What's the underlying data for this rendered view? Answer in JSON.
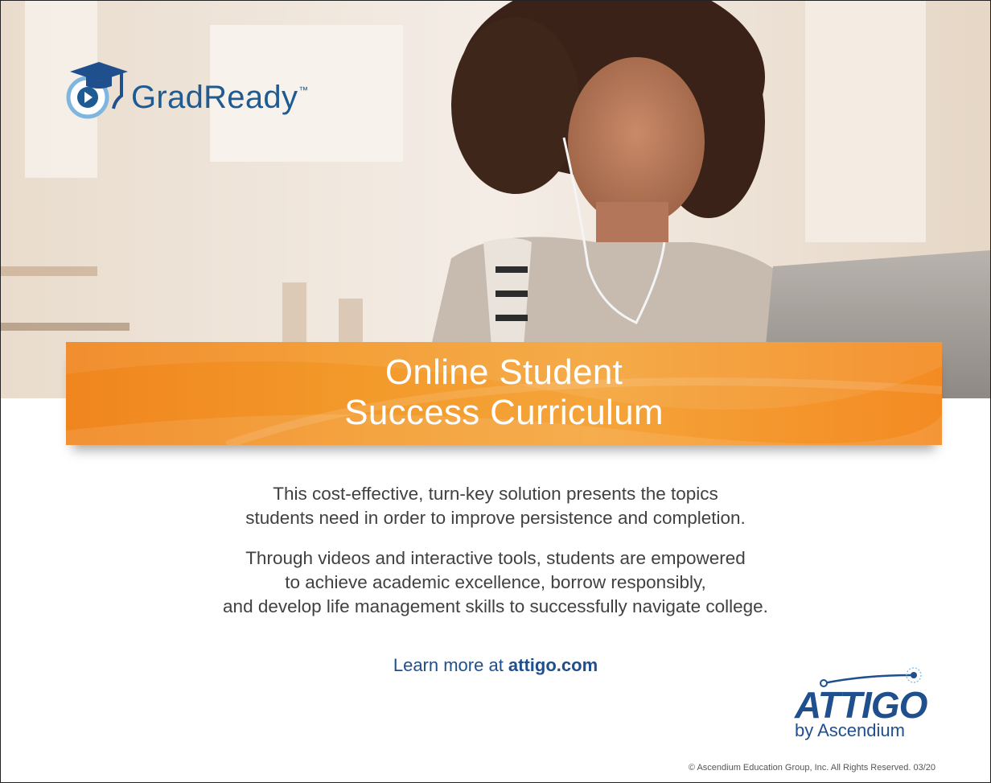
{
  "header": {
    "brand": "GradReady",
    "trademark": "™"
  },
  "banner": {
    "title_line1": "Online Student",
    "title_line2": "Success Curriculum"
  },
  "content": {
    "paragraph1_line1": "This cost-effective, turn-key solution presents the topics",
    "paragraph1_line2": "students need in order to improve persistence and completion.",
    "paragraph2_line1": "Through videos and interactive tools, students are empowered",
    "paragraph2_line2": "to achieve academic excellence, borrow responsibly,",
    "paragraph2_line3": "and develop life management skills to successfully navigate college.",
    "learn_more_prefix": "Learn more at ",
    "learn_more_link": "attigo.com"
  },
  "footer": {
    "company_logo": "ATTIGO",
    "company_tagline": "by Ascendium",
    "copyright": "© Ascendium Education Group, Inc. All Rights Reserved. 03/20"
  },
  "colors": {
    "brand_blue": "#1f4f8c",
    "banner_orange": "#f39a2b",
    "text_gray": "#414042"
  }
}
